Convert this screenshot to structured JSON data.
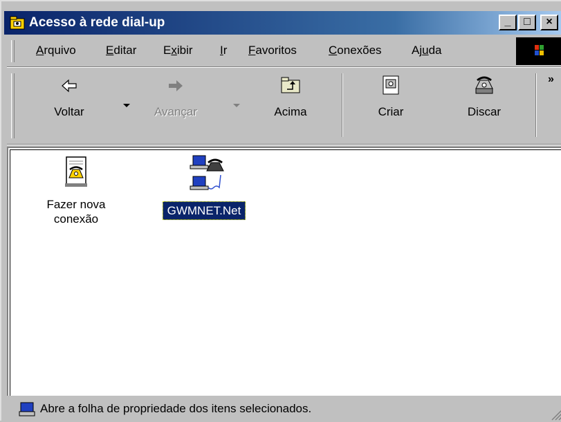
{
  "window": {
    "title": "Acesso à rede dial-up",
    "controls": {
      "minimize": "_",
      "maximize": "□",
      "close": "×"
    }
  },
  "menu": {
    "items": [
      {
        "pre": "",
        "key": "A",
        "post": "rquivo"
      },
      {
        "pre": "",
        "key": "E",
        "post": "ditar"
      },
      {
        "pre": "E",
        "key": "x",
        "post": "ibir"
      },
      {
        "pre": "",
        "key": "I",
        "post": "r"
      },
      {
        "pre": "",
        "key": "F",
        "post": "avoritos"
      },
      {
        "pre": "",
        "key": "C",
        "post": "onexões"
      },
      {
        "pre": "Aj",
        "key": "u",
        "post": "da"
      }
    ]
  },
  "toolbar": {
    "back": "Voltar",
    "forward": "Avançar",
    "up": "Acima",
    "create": "Criar",
    "dial": "Discar",
    "more": "»"
  },
  "icons": {
    "new_connection_line1": "Fazer nova",
    "new_connection_line2": "conexão",
    "connection": "GWMNET.Net"
  },
  "status": {
    "text": "Abre a folha de propriedade dos itens selecionados."
  },
  "colors": {
    "titlebar_start": "#0a246a",
    "titlebar_end": "#a6caf0",
    "selection": "#0a246a",
    "face": "#c0c0c0"
  }
}
